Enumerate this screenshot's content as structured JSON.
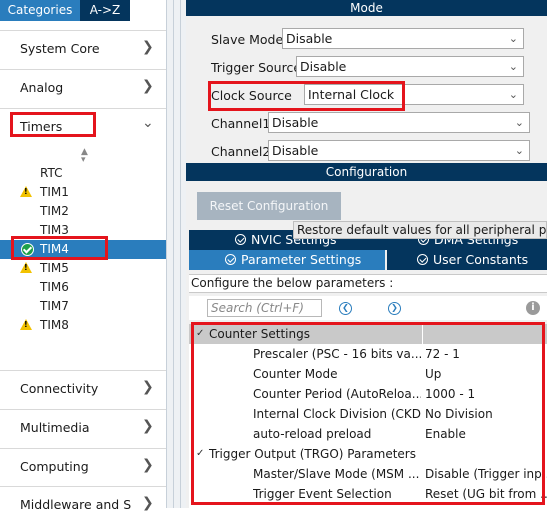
{
  "left_tabs": {
    "categories": "Categories",
    "az": "A->Z"
  },
  "categories": {
    "system_core": "System Core",
    "analog": "Analog",
    "timers": "Timers",
    "connectivity": "Connectivity",
    "multimedia": "Multimedia",
    "computing": "Computing",
    "middleware": "Middleware and S"
  },
  "timers": [
    {
      "label": "RTC",
      "status": "none"
    },
    {
      "label": "TIM1",
      "status": "warning"
    },
    {
      "label": "TIM2",
      "status": "none"
    },
    {
      "label": "TIM3",
      "status": "none"
    },
    {
      "label": "TIM4",
      "status": "checked-selected"
    },
    {
      "label": "TIM5",
      "status": "warning"
    },
    {
      "label": "TIM6",
      "status": "none"
    },
    {
      "label": "TIM7",
      "status": "none"
    },
    {
      "label": "TIM8",
      "status": "warning"
    }
  ],
  "mode": {
    "title": "Mode",
    "rows": [
      {
        "label": "Slave Mode",
        "value": "Disable"
      },
      {
        "label": "Trigger Source",
        "value": "Disable"
      },
      {
        "label": "Clock Source",
        "value": "Internal Clock"
      },
      {
        "label": "Channel1",
        "value": "Disable"
      },
      {
        "label": "Channel2",
        "value": "Disable"
      }
    ]
  },
  "configuration": {
    "title": "Configuration",
    "reset_button": "Reset Configuration",
    "tooltip": "Restore default values for all peripheral para",
    "tabs": {
      "nvic": "NVIC Settings",
      "dma": "DMA Settings",
      "params": "Parameter Settings",
      "user": "User Constants"
    },
    "hint": "Configure the below parameters :",
    "search_placeholder": "Search (Ctrl+F)"
  },
  "params": {
    "counter_group": "Counter Settings",
    "counter_rows": [
      {
        "name": "Prescaler (PSC - 16 bits va...",
        "value": "72 - 1"
      },
      {
        "name": "Counter Mode",
        "value": "Up"
      },
      {
        "name": "Counter Period (AutoReloa...",
        "value": "1000 - 1"
      },
      {
        "name": "Internal Clock Division (CKD)",
        "value": "No Division"
      },
      {
        "name": "auto-reload preload",
        "value": "Enable"
      }
    ],
    "trgo_group": "Trigger Output (TRGO) Parameters",
    "trgo_rows": [
      {
        "name": "Master/Slave Mode (MSM ...",
        "value": "Disable (Trigger inp..."
      },
      {
        "name": "Trigger Event Selection",
        "value": "Reset (UG bit from ..."
      }
    ]
  },
  "colors": {
    "navy": "#04355d",
    "blue": "#2a7dbd",
    "highlight_red": "#e4141c",
    "warning_yellow": "#f2c200",
    "ok_green": "#1fa14a"
  }
}
